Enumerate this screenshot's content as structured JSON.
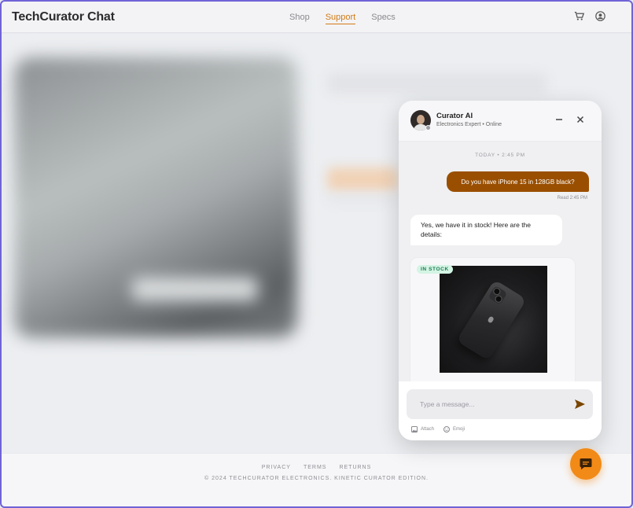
{
  "app": {
    "brand": "TechCurator Chat"
  },
  "nav": {
    "items": [
      {
        "label": "Shop",
        "active": false
      },
      {
        "label": "Support",
        "active": true
      },
      {
        "label": "Specs",
        "active": false
      }
    ]
  },
  "header_icons": [
    "cart-icon",
    "account-icon"
  ],
  "chat": {
    "agent_name": "Curator AI",
    "agent_status": "Electronics Expert • Online",
    "time_divider": "TODAY • 2:45 PM",
    "messages": [
      {
        "from": "user",
        "text": "Do you have iPhone 15 in 128GB black?",
        "meta": "Read 2:45 PM"
      },
      {
        "from": "agent",
        "text": "Yes, we have it in stock! Here are the details:"
      }
    ],
    "product_card": {
      "badge": "IN STOCK"
    },
    "input_placeholder": "Type a message...",
    "attach_label": "Attach",
    "emoji_label": "Emoji"
  },
  "footer": {
    "links": [
      "PRIVACY",
      "TERMS",
      "RETURNS"
    ],
    "copyright": "© 2024 TECHCURATOR ELECTRONICS. KINETIC CURATOR EDITION."
  },
  "colors": {
    "accent": "#d27a14",
    "user_bubble": "#9a4f00",
    "fab": "#f28a17",
    "stock_badge": "#d4f4e4"
  }
}
